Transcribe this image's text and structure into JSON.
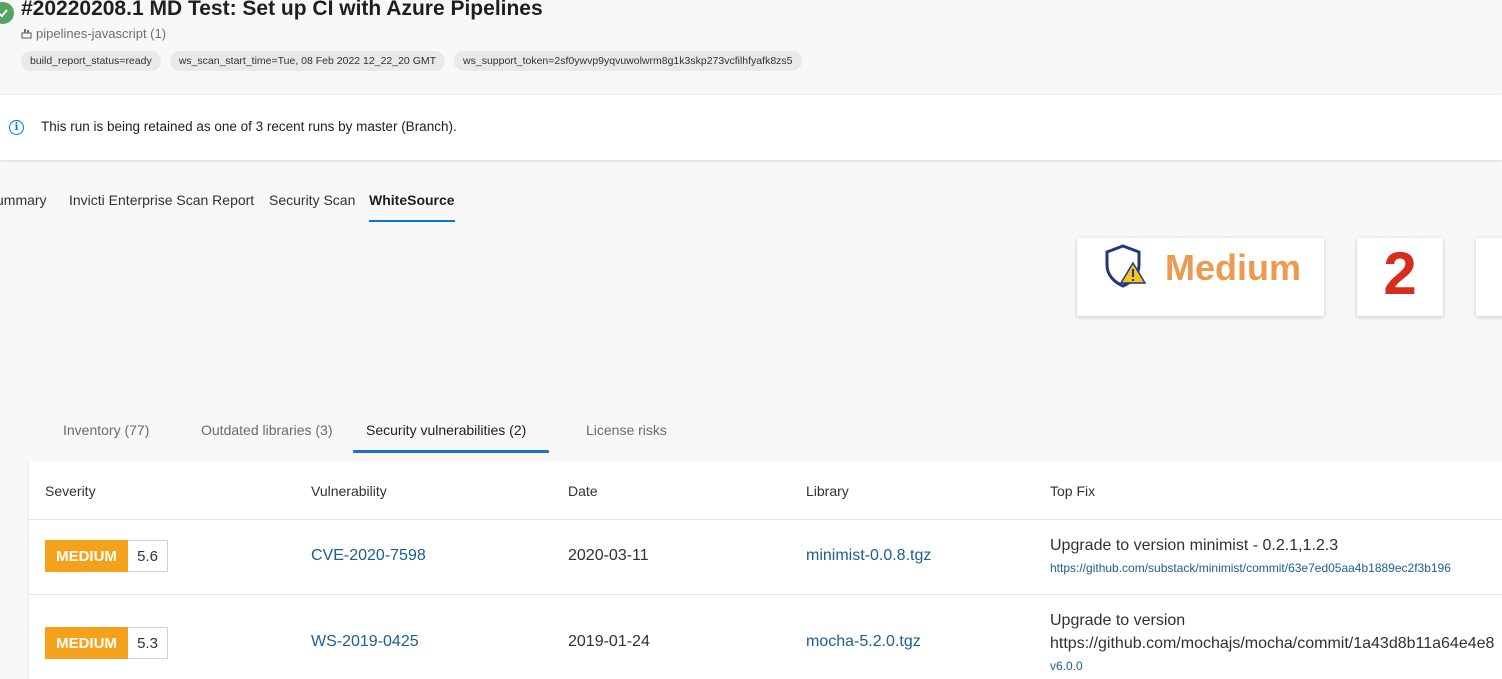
{
  "header": {
    "title": "#20220208.1 MD Test: Set up CI with Azure Pipelines",
    "repo": "pipelines-javascript (1)",
    "tags": [
      "build_report_status=ready",
      "ws_scan_start_time=Tue, 08 Feb 2022 12_22_20 GMT",
      "ws_support_token=2sf0ywvp9yqvuwolwrm8g1k3skp273vcfilhfyafk8zs5"
    ]
  },
  "banner": {
    "text": "This run is being retained as one of 3 recent runs by master (Branch)."
  },
  "top_tabs": [
    "ummary",
    "Invicti Enterprise Scan Report",
    "Security Scan",
    "WhiteSource"
  ],
  "summary": {
    "severity": "Medium",
    "count": "2",
    "severity_color": "#eb9a4f",
    "count_color": "#d82c1f"
  },
  "sub_tabs": [
    "Inventory (77)",
    "Outdated libraries (3)",
    "Security vulnerabilities (2)",
    "License risks"
  ],
  "table": {
    "headers": [
      "Severity",
      "Vulnerability",
      "Date",
      "Library",
      "Top Fix"
    ],
    "rows": [
      {
        "severity": "MEDIUM",
        "score": "5.6",
        "vulnerability": "CVE-2020-7598",
        "date": "2020-03-11",
        "library": "minimist-0.0.8.tgz",
        "fix_line1": "Upgrade to version minimist - 0.2.1,1.2.3",
        "fix_link": "https://github.com/substack/minimist/commit/63e7ed05aa4b1889ec2f3b196"
      },
      {
        "severity": "MEDIUM",
        "score": "5.3",
        "vulnerability": "WS-2019-0425",
        "date": "2019-01-24",
        "library": "mocha-5.2.0.tgz",
        "fix_line1": "Upgrade to version",
        "fix_line2": "https://github.com/mochajs/mocha/commit/1a43d8b11a64e4e8",
        "fix_link": "v6.0.0"
      }
    ]
  },
  "colors": {
    "accent": "#0078d4",
    "medium_badge": "#f4a21b",
    "success": "#55a362",
    "link": "#1b5e93"
  }
}
